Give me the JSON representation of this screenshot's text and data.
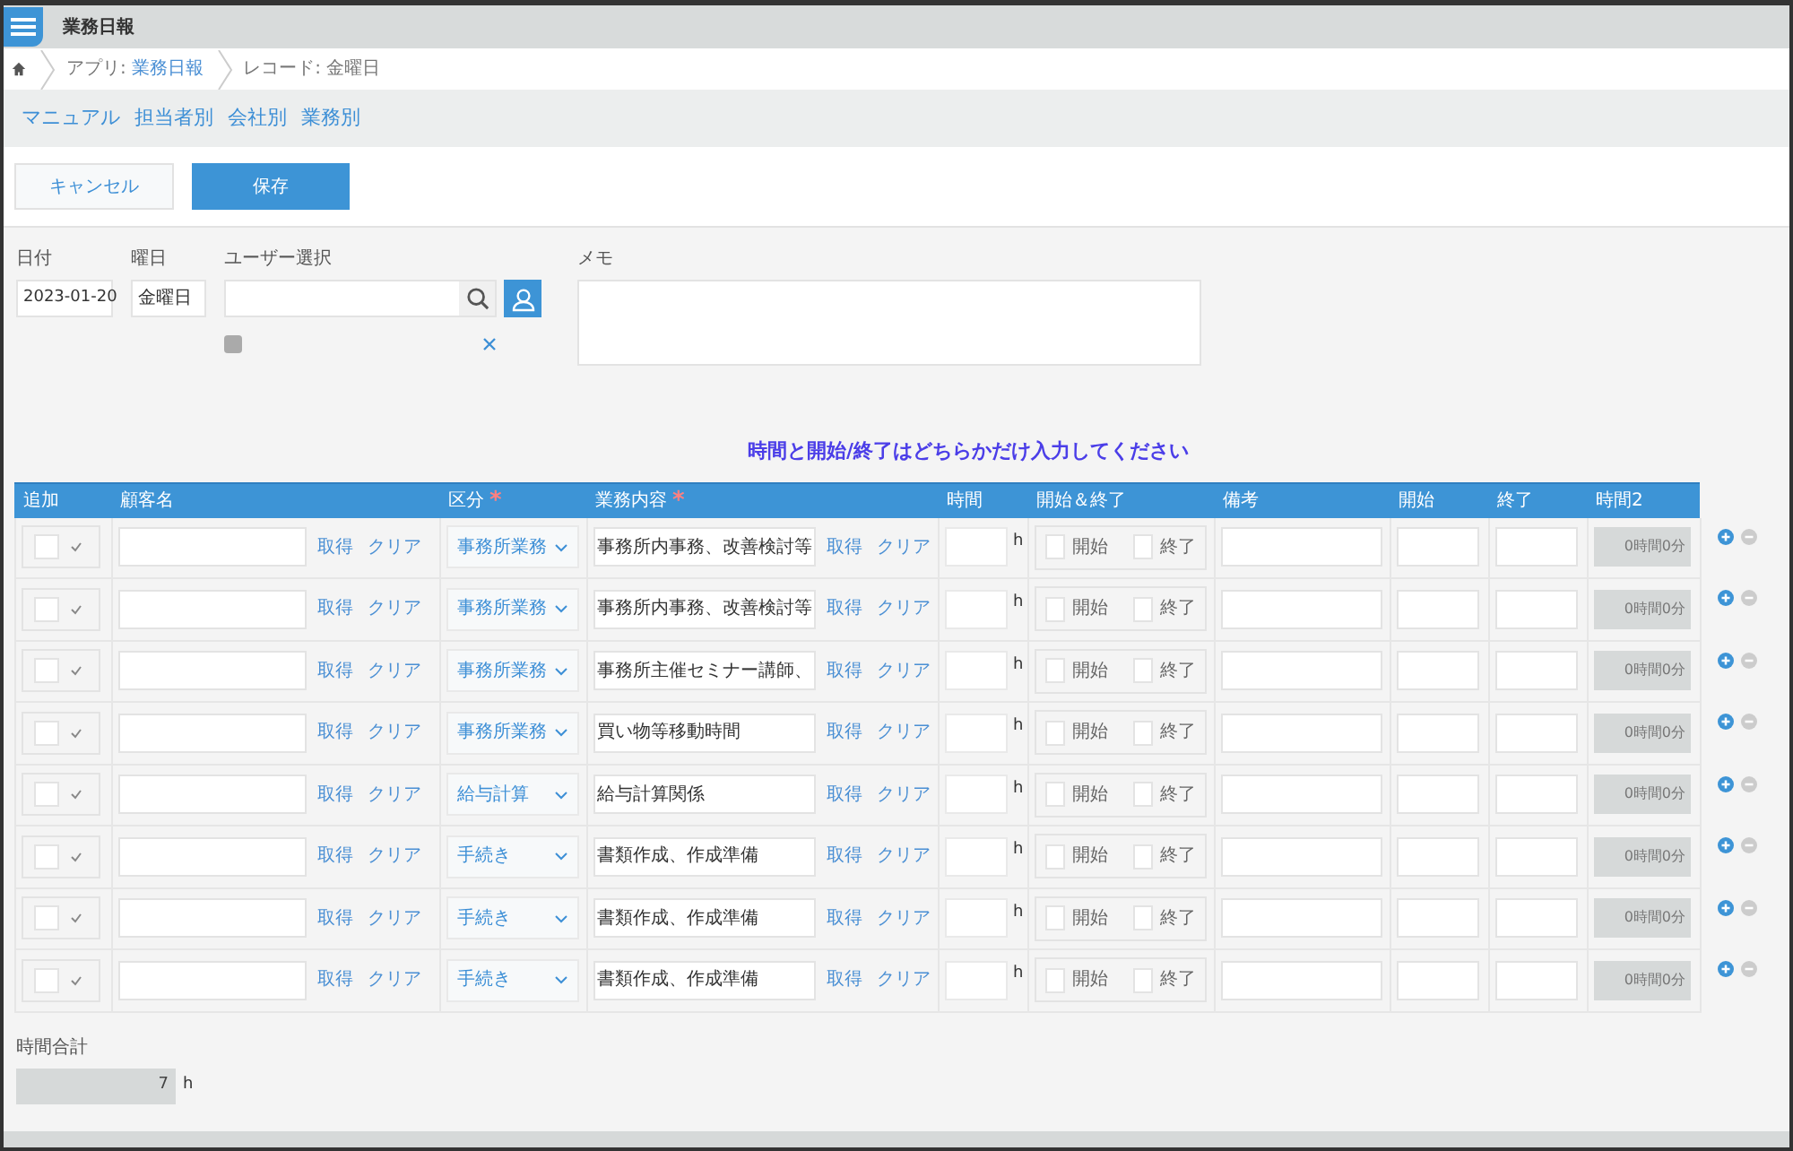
{
  "app_title": "業務日報",
  "breadcrumb": [
    {
      "label": "アプリ: ",
      "link": "業務日報"
    },
    {
      "label": "レコード: 金曜日"
    }
  ],
  "nav_links": [
    "マニュアル",
    "担当者別",
    "会社別",
    "業務別"
  ],
  "buttons": {
    "cancel": "キャンセル",
    "save": "保存"
  },
  "form": {
    "date": {
      "label": "日付",
      "value": "2023-01-20"
    },
    "weekday": {
      "label": "曜日",
      "value": "金曜日"
    },
    "user": {
      "label": "ユーザー選択"
    },
    "memo": {
      "label": "メモ"
    }
  },
  "notice": "時間と開始/終了はどちらかだけ入力してください",
  "table": {
    "columns": [
      {
        "label": "追加"
      },
      {
        "label": "顧客名"
      },
      {
        "label": "区分",
        "required_mark": "*"
      },
      {
        "label": "業務内容",
        "required_mark": "*"
      },
      {
        "label": "時間"
      },
      {
        "label": "開始＆終了"
      },
      {
        "label": "備考"
      },
      {
        "label": "開始"
      },
      {
        "label": "終了"
      },
      {
        "label": "時間2"
      }
    ],
    "rows": [
      {
        "checked": false,
        "customer_get": "取得",
        "customer_clear": "クリア",
        "category": "事務所業務",
        "task": "事務所内事務、改善検討等",
        "task_get": "取得",
        "task_clear": "クリア",
        "hour_unit": "h",
        "start_label": "開始",
        "start": false,
        "end_label": "終了",
        "end": false,
        "time2": "0時間0分"
      },
      {
        "checked": false,
        "customer_get": "取得",
        "customer_clear": "クリア",
        "category": "事務所業務",
        "task": "事務所内事務、改善検討等",
        "task_get": "取得",
        "task_clear": "クリア",
        "hour_unit": "h",
        "start_label": "開始",
        "start": false,
        "end_label": "終了",
        "end": false,
        "time2": "0時間0分"
      },
      {
        "checked": false,
        "customer_get": "取得",
        "customer_clear": "クリア",
        "category": "事務所業務",
        "task": "事務所主催セミナー講師、",
        "task_get": "取得",
        "task_clear": "クリア",
        "hour_unit": "h",
        "start_label": "開始",
        "start": false,
        "end_label": "終了",
        "end": false,
        "time2": "0時間0分"
      },
      {
        "checked": false,
        "customer_get": "取得",
        "customer_clear": "クリア",
        "category": "事務所業務",
        "task": "買い物等移動時間",
        "task_get": "取得",
        "task_clear": "クリア",
        "hour_unit": "h",
        "start_label": "開始",
        "start": false,
        "end_label": "終了",
        "end": false,
        "time2": "0時間0分"
      },
      {
        "checked": false,
        "customer_get": "取得",
        "customer_clear": "クリア",
        "category": "給与計算",
        "task": "給与計算関係",
        "task_get": "取得",
        "task_clear": "クリア",
        "hour_unit": "h",
        "start_label": "開始",
        "start": false,
        "end_label": "終了",
        "end": false,
        "time2": "0時間0分"
      },
      {
        "checked": false,
        "customer_get": "取得",
        "customer_clear": "クリア",
        "category": "手続き",
        "task": "書類作成、作成準備",
        "task_get": "取得",
        "task_clear": "クリア",
        "hour_unit": "h",
        "start_label": "開始",
        "start": false,
        "end_label": "終了",
        "end": false,
        "time2": "0時間0分"
      },
      {
        "checked": false,
        "customer_get": "取得",
        "customer_clear": "クリア",
        "category": "手続き",
        "task": "書類作成、作成準備",
        "task_get": "取得",
        "task_clear": "クリア",
        "hour_unit": "h",
        "start_label": "開始",
        "start": false,
        "end_label": "終了",
        "end": false,
        "time2": "0時間0分"
      },
      {
        "checked": false,
        "customer_get": "取得",
        "customer_clear": "クリア",
        "category": "手続き",
        "task": "書類作成、作成準備",
        "task_get": "取得",
        "task_clear": "クリア",
        "hour_unit": "h",
        "start_label": "開始",
        "start": false,
        "end_label": "終了",
        "end": false,
        "time2": "0時間0分"
      }
    ]
  },
  "total": {
    "label": "時間合計",
    "value": "7",
    "unit": "h"
  }
}
